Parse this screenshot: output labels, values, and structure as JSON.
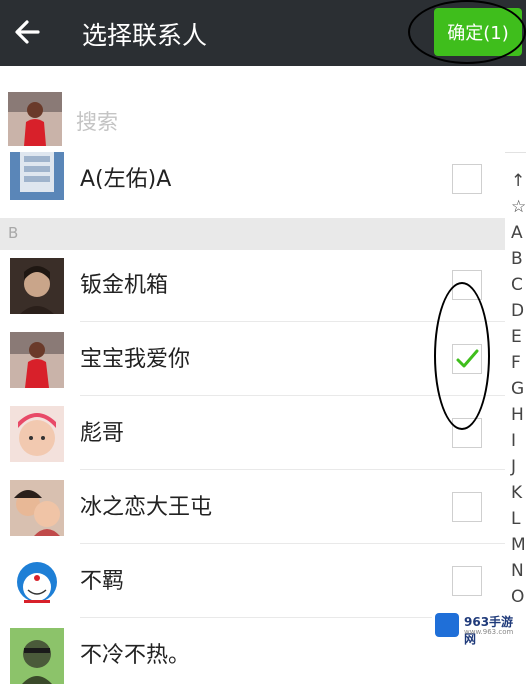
{
  "topbar": {
    "back_icon": "arrow-left-icon",
    "title": "选择联系人",
    "confirm_label": "确定(1)"
  },
  "search": {
    "placeholder": "搜索"
  },
  "contacts": [
    {
      "name": "A(左佑)A",
      "checked": false
    },
    {
      "section": "B"
    },
    {
      "name": "钣金机箱",
      "checked": false
    },
    {
      "name": "宝宝我爱你",
      "checked": true
    },
    {
      "name": "彪哥",
      "checked": false
    },
    {
      "name": "冰之恋大王屯",
      "checked": false
    },
    {
      "name": "不羁",
      "checked": false
    },
    {
      "name": "不冷不热。",
      "checked": false
    }
  ],
  "index_letters": [
    "↑",
    "☆",
    "A",
    "B",
    "C",
    "D",
    "E",
    "F",
    "G",
    "H",
    "I",
    "J",
    "K",
    "L",
    "M",
    "N",
    "O"
  ],
  "watermark": {
    "text": "963手游网",
    "sub": "www.963.com"
  },
  "colors": {
    "topbar": "#2b2f33",
    "accent": "#3fbe1c",
    "section_bg": "#e9e9e9"
  }
}
